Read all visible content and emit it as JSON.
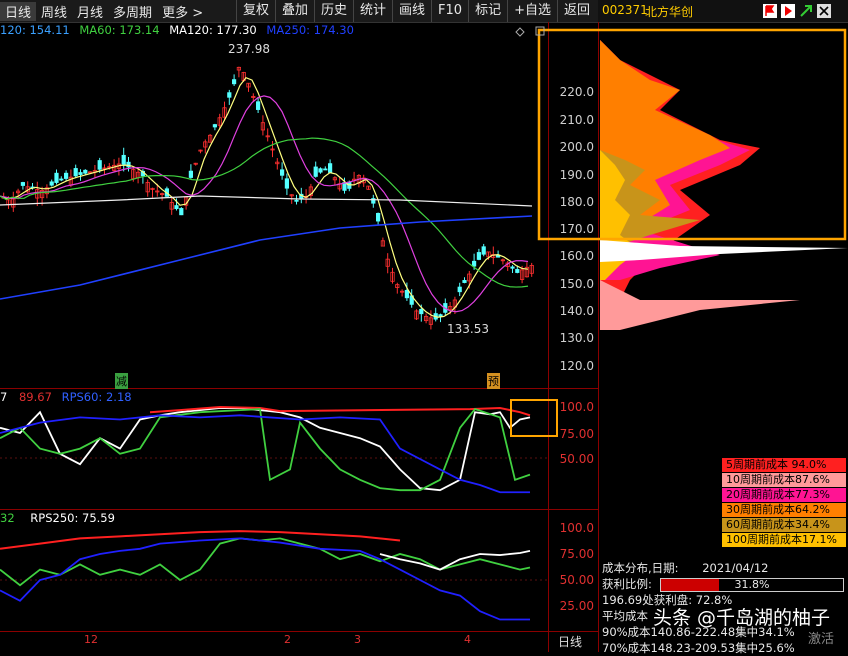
{
  "toolbar": {
    "left": [
      "日线",
      "周线",
      "月线",
      "多周期",
      "更多 >"
    ],
    "right": [
      "复权",
      "叠加",
      "历史",
      "统计",
      "画线",
      "F10",
      "标记",
      "+自选",
      "返回"
    ]
  },
  "stock": {
    "code": "002371",
    "name": "北方华创"
  },
  "ma_legend": [
    {
      "label": "120: 154.11",
      "color": "#3aa0ff"
    },
    {
      "label": "MA60: 173.14",
      "color": "#40d040"
    },
    {
      "label": "MA120: 177.30",
      "color": "#ffffff"
    },
    {
      "label": "MA250: 174.30",
      "color": "#2040ff"
    }
  ],
  "price_annotations": {
    "high": "237.98",
    "low": "133.53",
    "marker_jian": "减",
    "marker_yu": "预"
  },
  "price_axis": [
    "220.0",
    "210.0",
    "200.0",
    "190.0",
    "180.0",
    "170.0",
    "160.0",
    "150.0",
    "140.0",
    "130.0",
    "120.0"
  ],
  "rps_pane1": {
    "labels": [
      {
        "text": "7",
        "color": "#ffffff"
      },
      {
        "text": "89.67",
        "color": "#e03030"
      },
      {
        "text": "RPS60: 2.18",
        "color": "#3060ff"
      }
    ],
    "axis": [
      "100.0",
      "75.00",
      "50.00"
    ]
  },
  "rps_pane2": {
    "labels": [
      {
        "text": "32",
        "color": "#40d040"
      },
      {
        "text": "RPS250: 75.59",
        "color": "#ffffff"
      }
    ],
    "axis": [
      "100.0",
      "75.00",
      "50.00",
      "25.00"
    ]
  },
  "date_axis": [
    "12",
    "2",
    "3",
    "4"
  ],
  "bottom_tab": "日线",
  "cost_legend": [
    {
      "label": "5周期前成本 94.0%",
      "color": "#ff2020"
    },
    {
      "label": "10周期前成本87.6%",
      "color": "#ff9a9a"
    },
    {
      "label": "20周期前成本77.3%",
      "color": "#ff1493"
    },
    {
      "label": "30周期前成本64.2%",
      "color": "#ff7f00"
    },
    {
      "label": "60周期前成本34.4%",
      "color": "#c8941a"
    },
    {
      "label": "100周期前成本17.1%",
      "color": "#ffc000"
    }
  ],
  "cost_info": {
    "date_label": "成本分布,日期:",
    "date": "2021/04/12",
    "profit_label": "获利比例:",
    "profit_value": "31.8%",
    "profit_ratio": 0.318,
    "line1": "196.69处获利盘: 72.8%",
    "line2": "平均成本",
    "line3": "90%成本140.86-222.48集中34.1%",
    "line4": "70%成本148.23-209.53集中25.6%"
  },
  "watermark": {
    "text": "头条 @千岛湖的柚子",
    "corner": "激活"
  }
}
